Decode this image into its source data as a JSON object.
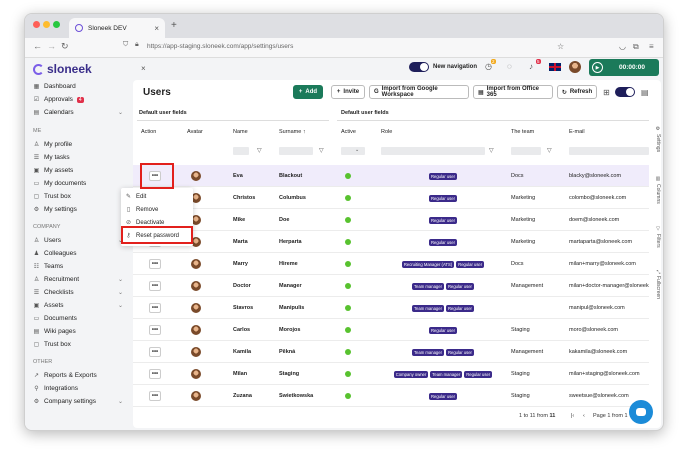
{
  "browser": {
    "tab_title": "Sloneek DEV",
    "url": "https://app-staging.sloneek.com/app/settings/users",
    "new_tab": "+",
    "tab_close": "×"
  },
  "brand": {
    "name": "sloneek"
  },
  "sidebar": {
    "items": [
      {
        "label": "Dashboard",
        "icon": "dashboard-icon"
      },
      {
        "label": "Approvals",
        "icon": "approvals-icon",
        "badge": "4"
      },
      {
        "label": "Calendars",
        "icon": "calendar-icon",
        "chevron": "⌄"
      }
    ],
    "me_heading": "ME",
    "me_items": [
      {
        "label": "My profile"
      },
      {
        "label": "My tasks"
      },
      {
        "label": "My assets"
      },
      {
        "label": "My documents"
      },
      {
        "label": "Trust box"
      },
      {
        "label": "My settings"
      }
    ],
    "company_heading": "COMPANY",
    "company_items": [
      {
        "label": "Users",
        "chevron": "⌄"
      },
      {
        "label": "Colleagues"
      },
      {
        "label": "Teams"
      },
      {
        "label": "Recruitment",
        "chevron": "⌄"
      },
      {
        "label": "Checklists",
        "chevron": "⌄"
      },
      {
        "label": "Assets",
        "chevron": "⌄"
      },
      {
        "label": "Documents"
      },
      {
        "label": "Wiki pages"
      },
      {
        "label": "Trust box"
      }
    ],
    "other_heading": "OTHER",
    "other_items": [
      {
        "label": "Reports & Exports"
      },
      {
        "label": "Integrations"
      },
      {
        "label": "Company settings",
        "chevron": "⌄"
      }
    ]
  },
  "topbar": {
    "close": "×",
    "new_navigation_label": "New navigation",
    "notif_badge_1": "2",
    "notif_badge_2": "5",
    "timer": "00:00:00"
  },
  "page": {
    "title": "Users",
    "add_label": "Add",
    "invite_label": "Invite",
    "google_label": "Import from Google Workspace",
    "office_label": "Import from Office 365",
    "refresh_label": "Refresh"
  },
  "table": {
    "group_left": "Default user fields",
    "group_right": "Default user fields",
    "headers": {
      "action": "Action",
      "avatar": "Avatar",
      "name": "Name",
      "surname": "Surname ↑",
      "active": "Active",
      "role": "Role",
      "team": "The team",
      "email": "E-mail"
    },
    "rows": [
      {
        "name": "Eva",
        "surname": "Blackout",
        "roles": [
          "Regular user"
        ],
        "team": "Docs",
        "email": "blacky@sloneek.com"
      },
      {
        "name": "Christos",
        "surname": "Columbus",
        "roles": [
          "Regular user"
        ],
        "team": "Marketing",
        "email": "colombo@sloneek.com"
      },
      {
        "name": "Mike",
        "surname": "Doe",
        "roles": [
          "Regular user"
        ],
        "team": "Marketing",
        "email": "doem@sloneek.com"
      },
      {
        "name": "Marta",
        "surname": "Herparta",
        "roles": [
          "Regular user"
        ],
        "team": "Marketing",
        "email": "martaparta@sloneek.com"
      },
      {
        "name": "Marry",
        "surname": "Hireme",
        "roles": [
          "Recruiting Manager (ATS)",
          "Regular user"
        ],
        "team": "Docs",
        "email": "milan+marry@sloneek.com"
      },
      {
        "name": "Doctor",
        "surname": "Manager",
        "roles": [
          "Team manager",
          "Regular user"
        ],
        "team": "Management",
        "email": "milan+doctor-manager@sloneek"
      },
      {
        "name": "Stavros",
        "surname": "Manipulis",
        "roles": [
          "Team manager",
          "Regular user"
        ],
        "team": "",
        "email": "manipul@sloneek.com"
      },
      {
        "name": "Carlos",
        "surname": "Morojos",
        "roles": [
          "Regular user"
        ],
        "team": "Staging",
        "email": "moro@sloneek.com"
      },
      {
        "name": "Kamila",
        "surname": "Pěkná",
        "roles": [
          "Team manager",
          "Regular user"
        ],
        "team": "Management",
        "email": "kakamila@sloneek.com"
      },
      {
        "name": "Milan",
        "surname": "Staging",
        "roles": [
          "Company owner",
          "Team manager",
          "Regular user"
        ],
        "team": "Staging",
        "email": "milan+staging@sloneek.com"
      },
      {
        "name": "Zuzana",
        "surname": "Swietkowska",
        "roles": [
          "Regular user"
        ],
        "team": "Staging",
        "email": "sweetsue@sloneek.com"
      }
    ],
    "pagination_count_prefix": "1 to 11 from",
    "pagination_count_total": "11",
    "pagination_page": "Page 1 from 1"
  },
  "context_menu": {
    "edit": "Edit",
    "remove": "Remove",
    "deactivate": "Deactivate",
    "reset_password": "Reset password"
  },
  "right_panel": {
    "settings": "Settings",
    "columns": "Columns",
    "filters": "Filters",
    "fullscreen": "Fullscreen"
  },
  "colors": {
    "accent_green": "#1b7a5a",
    "brand_purple": "#3b2a8a",
    "highlight_red": "#e2201c"
  }
}
